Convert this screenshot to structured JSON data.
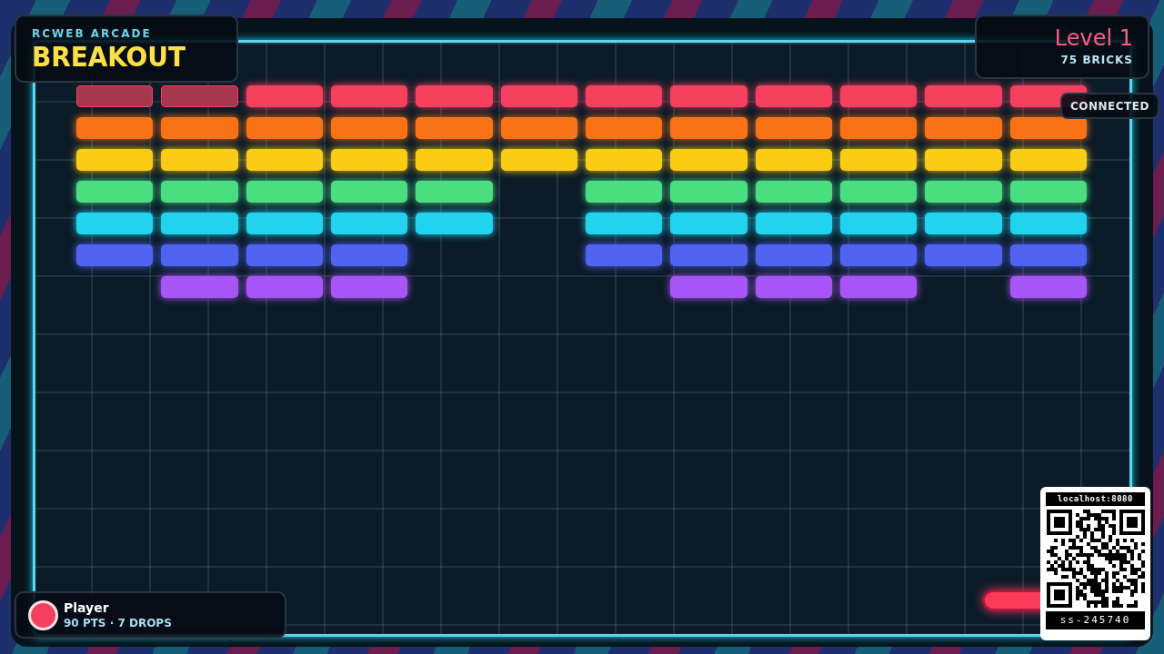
{
  "header": {
    "brand": "RCWEB ARCADE",
    "title": "BREAKOUT"
  },
  "level_panel": {
    "level": "Level 1",
    "bricks": "75 BRICKS"
  },
  "connection": {
    "label": "CONNECTED"
  },
  "brick_rows": [
    {
      "color": "#f43f5e",
      "slots": [
        {
          "kind": "brick",
          "faded": true
        },
        {
          "kind": "brick",
          "faded": true
        },
        {
          "kind": "brick",
          "faded": false
        },
        {
          "kind": "brick",
          "faded": false
        },
        {
          "kind": "brick",
          "faded": false
        },
        {
          "kind": "brick",
          "faded": false
        },
        {
          "kind": "brick",
          "faded": false
        },
        {
          "kind": "brick",
          "faded": false
        },
        {
          "kind": "brick",
          "faded": false
        },
        {
          "kind": "brick",
          "faded": false
        },
        {
          "kind": "brick",
          "faded": false
        },
        {
          "kind": "brick",
          "faded": false
        }
      ]
    },
    {
      "color": "#f97316",
      "slots": [
        {
          "kind": "brick",
          "faded": false
        },
        {
          "kind": "brick",
          "faded": false
        },
        {
          "kind": "brick",
          "faded": false
        },
        {
          "kind": "brick",
          "faded": false
        },
        {
          "kind": "brick",
          "faded": false
        },
        {
          "kind": "brick",
          "faded": false
        },
        {
          "kind": "brick",
          "faded": false
        },
        {
          "kind": "brick",
          "faded": false
        },
        {
          "kind": "brick",
          "faded": false
        },
        {
          "kind": "brick",
          "faded": false
        },
        {
          "kind": "brick",
          "faded": false
        },
        {
          "kind": "brick",
          "faded": false
        }
      ]
    },
    {
      "color": "#facc15",
      "slots": [
        {
          "kind": "brick",
          "faded": false
        },
        {
          "kind": "brick",
          "faded": false
        },
        {
          "kind": "brick",
          "faded": false
        },
        {
          "kind": "brick",
          "faded": false
        },
        {
          "kind": "brick",
          "faded": false
        },
        {
          "kind": "brick",
          "faded": false
        },
        {
          "kind": "brick",
          "faded": false
        },
        {
          "kind": "brick",
          "faded": false
        },
        {
          "kind": "brick",
          "faded": false
        },
        {
          "kind": "brick",
          "faded": false
        },
        {
          "kind": "brick",
          "faded": false
        },
        {
          "kind": "brick",
          "faded": false
        }
      ]
    },
    {
      "color": "#4ade80",
      "slots": [
        {
          "kind": "brick",
          "faded": false
        },
        {
          "kind": "brick",
          "faded": false
        },
        {
          "kind": "brick",
          "faded": false
        },
        {
          "kind": "brick",
          "faded": false
        },
        {
          "kind": "brick",
          "faded": false
        },
        {
          "kind": "empty"
        },
        {
          "kind": "brick",
          "faded": false
        },
        {
          "kind": "brick",
          "faded": false
        },
        {
          "kind": "brick",
          "faded": false
        },
        {
          "kind": "brick",
          "faded": false
        },
        {
          "kind": "brick",
          "faded": false
        },
        {
          "kind": "brick",
          "faded": false
        }
      ]
    },
    {
      "color": "#22d3ee",
      "slots": [
        {
          "kind": "brick",
          "faded": false
        },
        {
          "kind": "brick",
          "faded": false
        },
        {
          "kind": "brick",
          "faded": false
        },
        {
          "kind": "brick",
          "faded": false
        },
        {
          "kind": "brick",
          "faded": false
        },
        {
          "kind": "empty"
        },
        {
          "kind": "brick",
          "faded": false
        },
        {
          "kind": "brick",
          "faded": false
        },
        {
          "kind": "brick",
          "faded": false
        },
        {
          "kind": "brick",
          "faded": false
        },
        {
          "kind": "brick",
          "faded": false
        },
        {
          "kind": "brick",
          "faded": false
        }
      ]
    },
    {
      "color": "#4f63f0",
      "slots": [
        {
          "kind": "brick",
          "faded": false
        },
        {
          "kind": "brick",
          "faded": false
        },
        {
          "kind": "brick",
          "faded": false
        },
        {
          "kind": "brick",
          "faded": false
        },
        {
          "kind": "empty"
        },
        {
          "kind": "empty"
        },
        {
          "kind": "brick",
          "faded": false
        },
        {
          "kind": "brick",
          "faded": false
        },
        {
          "kind": "brick",
          "faded": false
        },
        {
          "kind": "brick",
          "faded": false
        },
        {
          "kind": "brick",
          "faded": false
        },
        {
          "kind": "brick",
          "faded": false
        }
      ]
    },
    {
      "color": "#a855f7",
      "slots": [
        {
          "kind": "empty"
        },
        {
          "kind": "brick",
          "faded": false
        },
        {
          "kind": "brick",
          "faded": false
        },
        {
          "kind": "brick",
          "faded": false
        },
        {
          "kind": "empty"
        },
        {
          "kind": "empty"
        },
        {
          "kind": "empty"
        },
        {
          "kind": "brick",
          "faded": false
        },
        {
          "kind": "brick",
          "faded": false
        },
        {
          "kind": "brick",
          "faded": false
        },
        {
          "kind": "empty"
        },
        {
          "kind": "brick",
          "faded": false
        }
      ]
    }
  ],
  "player": {
    "name": "Player",
    "color": "#f43f5e",
    "stats": "90 PTS · 7 DROPS"
  },
  "qr": {
    "url": "localhost:8080",
    "code": "ss-245740"
  }
}
